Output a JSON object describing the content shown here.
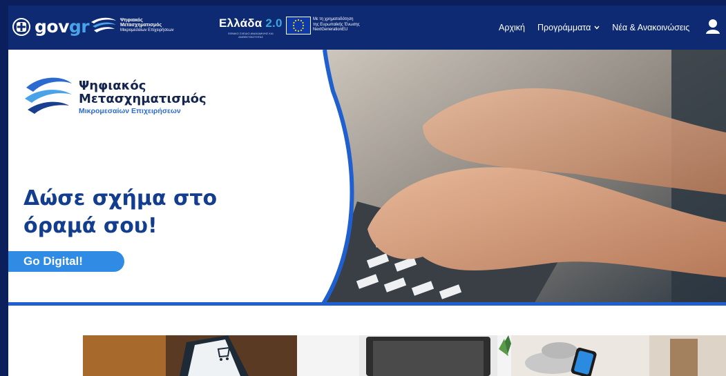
{
  "nav": {
    "gov_logo_text_a": "gov",
    "gov_logo_text_b": "gr",
    "dm_small": {
      "line1": "Ψηφιακός",
      "line2": "Μετασχηματισμός",
      "line3": "Μικρομεσαίων Επιχειρήσεων"
    },
    "ellada": {
      "title": "Ελλάδα",
      "version": "2.0",
      "subtitle": "ΕΘΝΙΚΟ ΣΧΕΔΙΟ ΑΝΑΚΑΜΨΗΣ ΚΑΙ ΑΝΘΕΚΤΙΚΟΤΗΤΑΣ"
    },
    "eu": {
      "line1": "Με τη χρηματοδότηση",
      "line2": "της Ευρωπαϊκής Ένωσης",
      "line3": "NextGenerationEU"
    },
    "links": [
      {
        "label": "Αρχική"
      },
      {
        "label": "Προγράμματα"
      },
      {
        "label": "Νέα & Ανακοινώσεις"
      }
    ],
    "user_icon": "user-icon"
  },
  "hero": {
    "brand": {
      "line1": "Ψηφιακός",
      "line2": "Μετασχηματισμός",
      "line3": "Μικρομεσαίων Επιχειρήσεων"
    },
    "headline_line1": "Δώσε σχήμα στο",
    "headline_line2": "όραμά σου!",
    "cta": "Go Digital!"
  },
  "colors": {
    "navbar": "#0d2a72",
    "accent_blue": "#2f8be3",
    "headline": "#133d8e",
    "outer_frame": "#0b1f5c"
  }
}
